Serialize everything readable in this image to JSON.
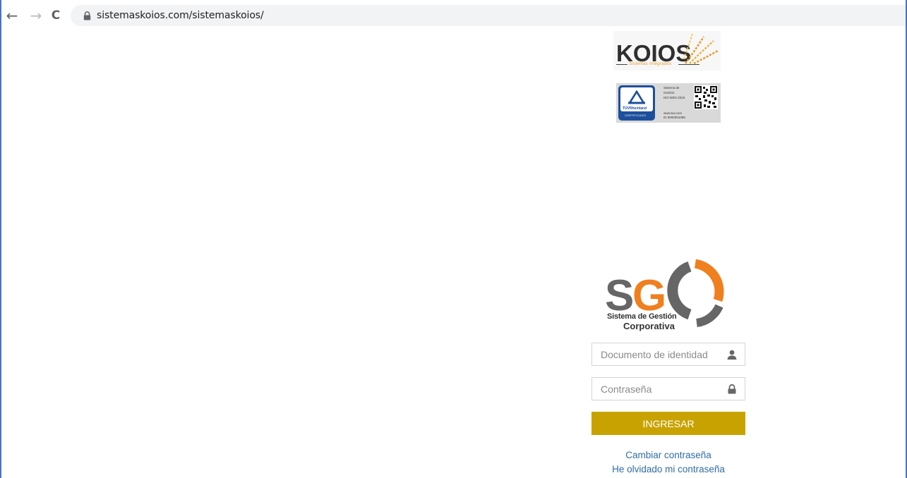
{
  "browser": {
    "back_icon": "←",
    "forward_icon": "→",
    "reload_icon": "C",
    "url": "sistemaskoios.com/sistemaskoios/"
  },
  "koios_logo": {
    "name": "KOIOS",
    "tagline": "Sistemas Integrados",
    "accent_color": "#e39a22"
  },
  "certification": {
    "brand": "TÜVRheinland",
    "seal_text": "CERTIFICADO",
    "lines": [
      "Sistema de",
      "Gestión",
      "ISO 9001:2015"
    ],
    "footer_lines": [
      "www.tuv.com",
      "ID 9000004488"
    ]
  },
  "sgc_logo": {
    "letters": "SGC",
    "line1": "Sistema de Gestión",
    "line2": "Corporativa"
  },
  "login": {
    "document_placeholder": "Documento de identidad",
    "document_icon": "user-icon",
    "password_placeholder": "Contraseña",
    "password_icon": "lock-icon",
    "submit_label": "INGRESAR",
    "submit_color": "#c8a300",
    "change_password_link": "Cambiar contraseña",
    "forgot_password_link": "He olvidado mi contraseña"
  }
}
